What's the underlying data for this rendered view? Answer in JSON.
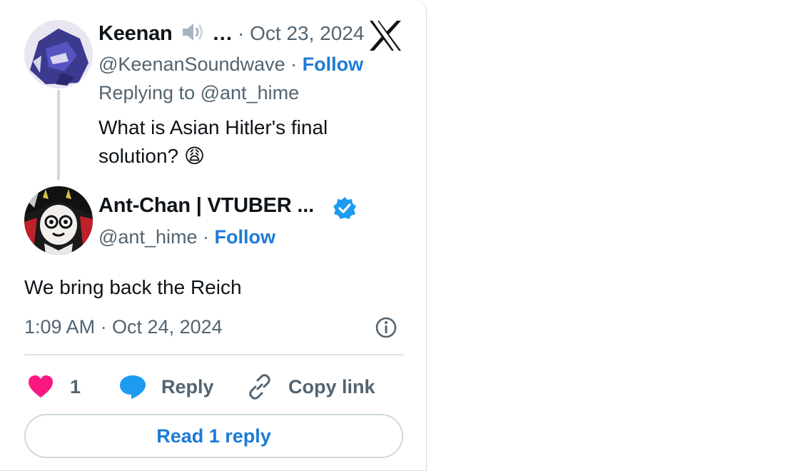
{
  "parent_tweet": {
    "author_name": "Keenan",
    "name_suffix": "…",
    "date": "· Oct 23, 2024",
    "handle": "@KeenanSoundwave",
    "separator": "·",
    "follow_label": "Follow",
    "replying_prefix": "Replying to",
    "replying_handle": "@ant_hime",
    "text_line1": "What is Asian Hitler's final",
    "text_line2": "solution?",
    "emoji": "😩"
  },
  "main_tweet": {
    "author_name": "Ant-Chan | VTUBER ...",
    "verified": true,
    "handle": "@ant_hime",
    "separator": "·",
    "follow_label": "Follow",
    "text": "We bring back the Reich",
    "timestamp": "1:09 AM · Oct 24, 2024"
  },
  "actions": {
    "like_count": "1",
    "reply_label": "Reply",
    "copy_link_label": "Copy link"
  },
  "read_replies_label": "Read 1 reply",
  "colors": {
    "accent": "#1d7bd6",
    "like": "#f91880",
    "muted": "#536471",
    "verified": "#1d9bf0"
  },
  "icons": [
    "speaker-icon",
    "x-logo-icon",
    "verified-badge-icon",
    "info-icon",
    "heart-icon",
    "reply-bubble-icon",
    "link-icon"
  ]
}
